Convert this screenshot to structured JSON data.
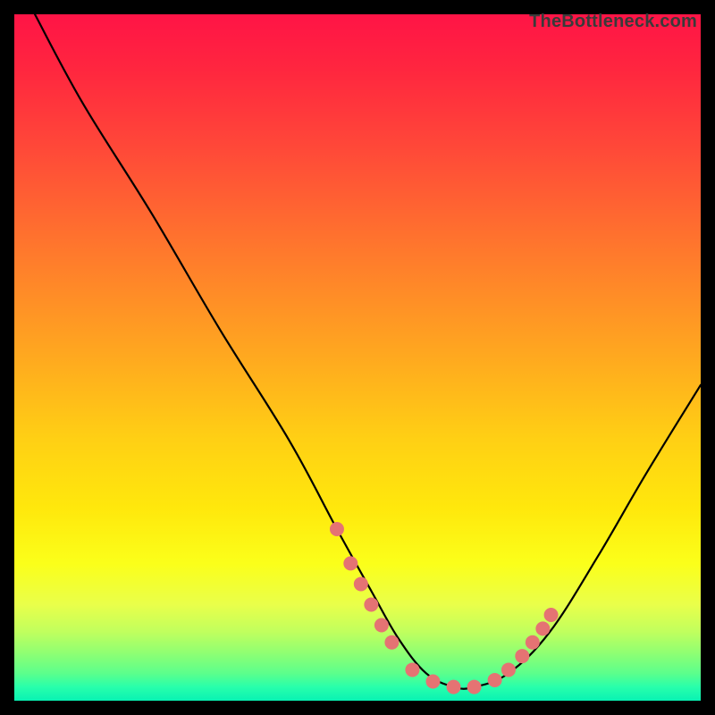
{
  "watermark": "TheBottleneck.com",
  "colors": {
    "curve_stroke": "#000000",
    "marker_fill": "#e57373",
    "marker_stroke": "#c05757",
    "background_frame": "#000000"
  },
  "chart_data": {
    "type": "line",
    "title": "",
    "xlabel": "",
    "ylabel": "",
    "xlim": [
      0,
      100
    ],
    "ylim": [
      0,
      100
    ],
    "grid": false,
    "legend": false,
    "annotations": [],
    "series": [
      {
        "name": "curve",
        "x": [
          3,
          10,
          20,
          30,
          40,
          47,
          52,
          56,
          60,
          64,
          67,
          72,
          78,
          85,
          92,
          100
        ],
        "y": [
          100,
          87,
          71,
          54,
          38,
          25,
          16,
          9,
          4,
          2,
          2,
          4,
          10,
          21,
          33,
          46
        ]
      }
    ],
    "markers": {
      "name": "highlight-band",
      "x": [
        47,
        49,
        50.5,
        52,
        53.5,
        55,
        58,
        61,
        64,
        67,
        70,
        72,
        74,
        75.5,
        77,
        78.2
      ],
      "y": [
        25,
        20,
        17,
        14,
        11,
        8.5,
        4.5,
        2.8,
        2,
        2,
        3,
        4.5,
        6.5,
        8.5,
        10.5,
        12.5
      ]
    }
  }
}
